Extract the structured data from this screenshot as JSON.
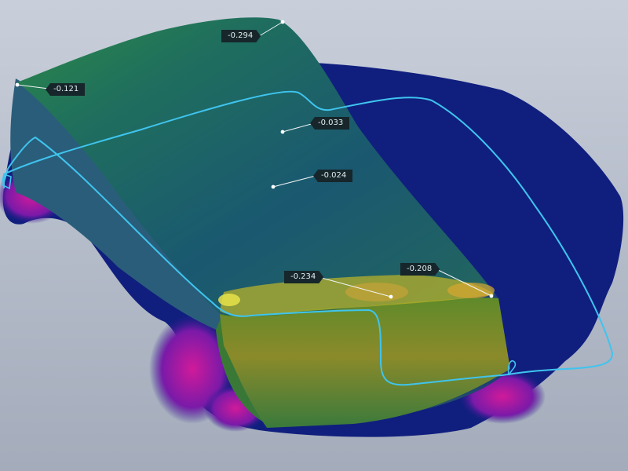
{
  "deviation_labels": [
    {
      "value": "-0.294"
    },
    {
      "value": "-0.121"
    },
    {
      "value": "-0.033"
    },
    {
      "value": "-0.024"
    },
    {
      "value": "-0.234"
    },
    {
      "value": "-0.208"
    }
  ],
  "colors": {
    "background_top": "#c9cfda",
    "background_bottom": "#a4acbb",
    "base_blue": "#0f1f80",
    "top_teal": "#1a5a6e",
    "edge_green": "#2f8a3c",
    "hot_yellow": "#c6a52a",
    "magenta": "#c4188f",
    "section_line": "#3fc4ee",
    "label_bg": "#16262a",
    "label_text": "#e4eef0"
  }
}
